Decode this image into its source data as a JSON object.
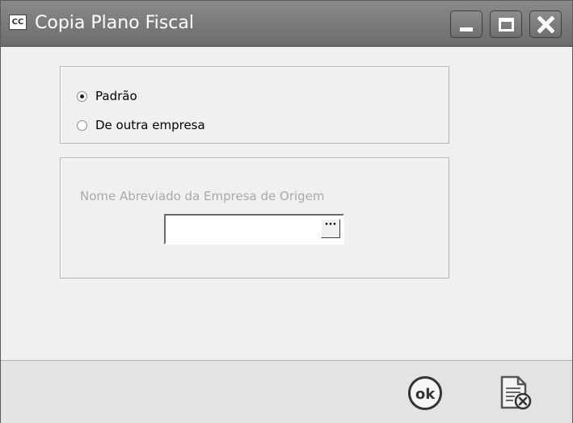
{
  "window": {
    "icon_text": "CC",
    "title": "Copia Plano Fiscal"
  },
  "source_options": [
    {
      "label": "Padrão",
      "checked": true
    },
    {
      "label": "De outra empresa",
      "checked": false
    }
  ],
  "origin": {
    "label": "Nome Abreviado da Empresa de Origem",
    "value": "",
    "lookup_label": "···"
  },
  "footer": {
    "ok_label": "ok"
  }
}
